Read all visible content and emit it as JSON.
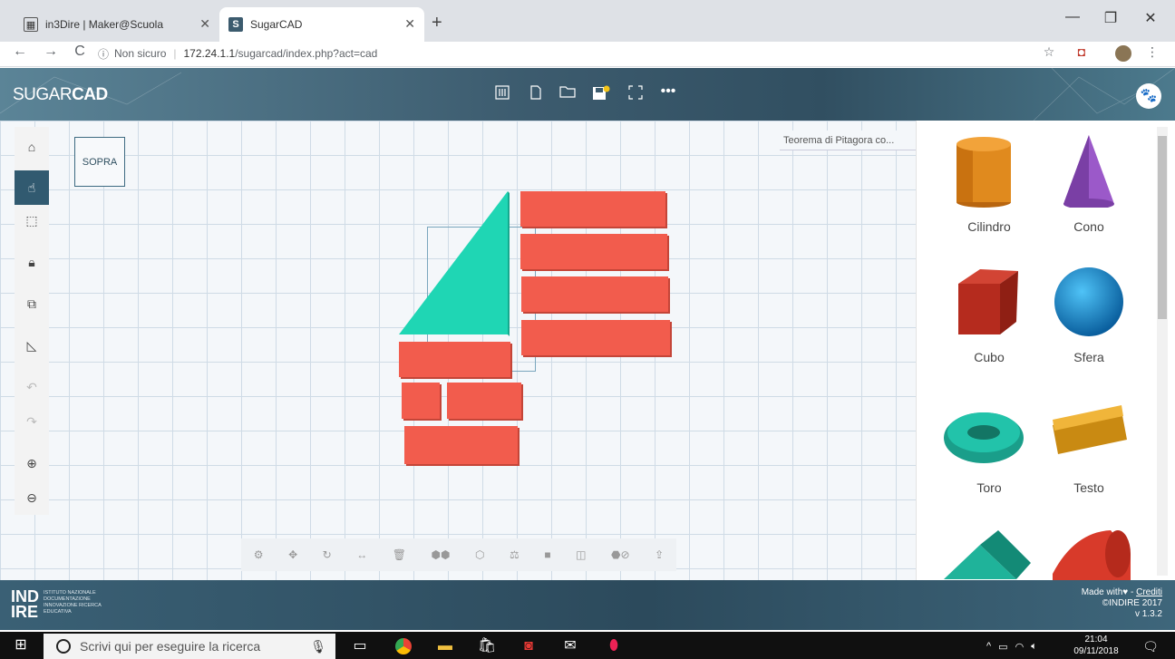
{
  "browser": {
    "tabs": [
      {
        "title": "in3Dire | Maker@Scuola",
        "active": false
      },
      {
        "title": "SugarCAD",
        "active": true
      }
    ],
    "new_tab_label": "+",
    "address": {
      "security": "Non sicuro",
      "host": "172.24.1.1",
      "path": "/sugarcad/index.php?act=cad"
    }
  },
  "app": {
    "logo_light": "SUGAR",
    "logo_bold": "CAD",
    "view_label": "SOPRA",
    "project_title": "Teorema di Pitagora co..."
  },
  "shapes": [
    {
      "label": "Cilindro"
    },
    {
      "label": "Cono"
    },
    {
      "label": "Cubo"
    },
    {
      "label": "Sfera"
    },
    {
      "label": "Toro"
    },
    {
      "label": "Testo"
    }
  ],
  "footer": {
    "logo_line1": "IND",
    "logo_line2": "IRE",
    "logo_sub": "ISTITUTO NAZIONALE DOCUMENTAZIONE INNOVAZIONE RICERCA EDUCATIVA",
    "made_with": "Made with",
    "credits": "Crediti",
    "copyright": "©INDIRE 2017",
    "version": "v 1.3.2"
  },
  "taskbar": {
    "search_placeholder": "Scrivi qui per eseguire la ricerca",
    "time": "21:04",
    "date": "09/11/2018"
  },
  "colors": {
    "header": "#3c5b6e",
    "brick": "#f25c4d",
    "triangle": "#1fd6b4",
    "active_tool": "#315a70"
  }
}
